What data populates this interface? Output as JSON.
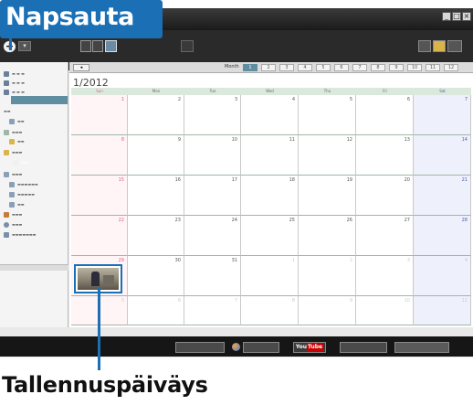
{
  "callouts": {
    "top_label": "Napsauta",
    "bottom_label": "Tallennuspäiväys"
  },
  "toolbar": {
    "import_label": "+",
    "import_dropdown": "▾"
  },
  "calendar": {
    "title": "1/2012",
    "back_label": "◂",
    "month_label": "Month",
    "month_buttons": [
      "1",
      "2",
      "3",
      "4",
      "5",
      "6",
      "7",
      "8",
      "9",
      "10",
      "11",
      "12"
    ],
    "weekdays": [
      "Sun",
      "Mon",
      "Tue",
      "Wed",
      "Thu",
      "Fri",
      "Sat"
    ],
    "weeks": [
      [
        "1",
        "2",
        "3",
        "4",
        "5",
        "6",
        "7"
      ],
      [
        "8",
        "9",
        "10",
        "11",
        "12",
        "13",
        "14"
      ],
      [
        "15",
        "16",
        "17",
        "18",
        "19",
        "20",
        "21"
      ],
      [
        "22",
        "23",
        "24",
        "25",
        "26",
        "27",
        "28"
      ],
      [
        "29",
        "30",
        "31",
        "1",
        "2",
        "3",
        "4"
      ],
      [
        "5",
        "6",
        "7",
        "8",
        "9",
        "10",
        "11"
      ]
    ]
  },
  "colors": {
    "callout_blue": "#1a6fb5",
    "sidebar_selection": "#5f8ea1",
    "sunday_text": "#e06080",
    "saturday_text": "#4a60b0"
  },
  "bottombar": {
    "youtube_you": "You",
    "youtube_tube": "Tube"
  }
}
